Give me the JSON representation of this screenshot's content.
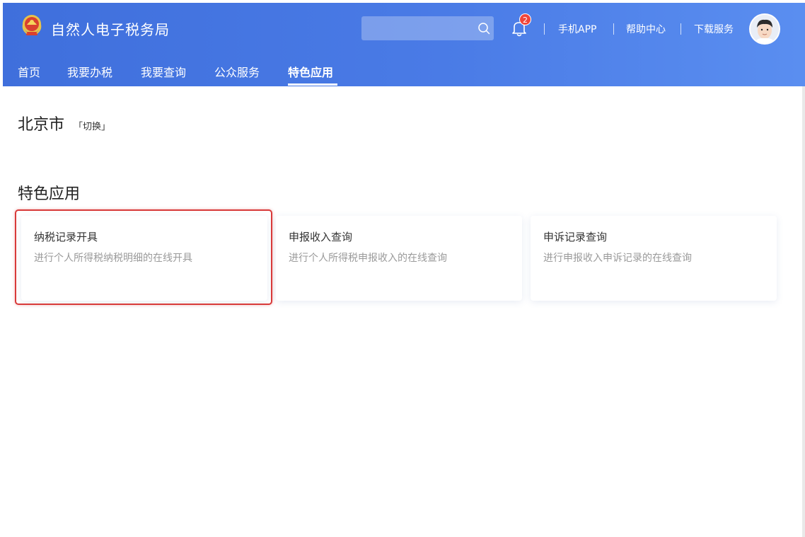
{
  "header": {
    "title": "自然人电子税务局",
    "search": {
      "value": "",
      "placeholder": ""
    },
    "notification_count": "2",
    "links": [
      {
        "label": "手机APP"
      },
      {
        "label": "帮助中心"
      },
      {
        "label": "下载服务"
      }
    ],
    "nav": [
      {
        "label": "首页"
      },
      {
        "label": "我要办税"
      },
      {
        "label": "我要查询"
      },
      {
        "label": "公众服务"
      },
      {
        "label": "特色应用"
      }
    ],
    "active_nav": "特色应用"
  },
  "region": {
    "city": "北京市",
    "switch_label": "「切换」"
  },
  "section": {
    "title": "特色应用",
    "cards": [
      {
        "title": "纳税记录开具",
        "desc": "进行个人所得税纳税明细的在线开具"
      },
      {
        "title": "申报收入查询",
        "desc": "进行个人所得税申报收入的在线查询"
      },
      {
        "title": "申诉记录查询",
        "desc": "进行申报收入申诉记录的在线查询"
      }
    ]
  },
  "icons": {
    "logo": "tax-emblem-icon",
    "search": "search-icon",
    "bell": "bell-icon",
    "avatar": "user-avatar"
  },
  "colors": {
    "header_start": "#3f6fdc",
    "header_end": "#5a8ef0",
    "badge": "#f0453a",
    "highlight_border": "#d83a3a"
  }
}
